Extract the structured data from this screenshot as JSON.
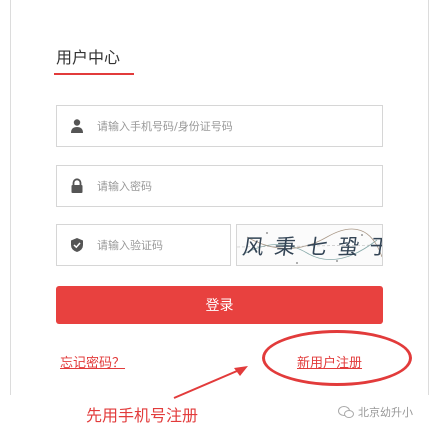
{
  "header": {
    "title": "用户中心"
  },
  "form": {
    "phone_placeholder": "请输入手机号码/身份证号码",
    "password_placeholder": "请输入密码",
    "captcha_placeholder": "请输入验证码",
    "captcha_text": "风 秉 七 蛩 于",
    "login_label": "登录"
  },
  "links": {
    "forgot_password": "忘记密码？",
    "register": "新用户注册"
  },
  "annotation": {
    "text": "先用手机号注册"
  },
  "watermark": {
    "text": "北京幼升小"
  },
  "colors": {
    "accent": "#e8413f",
    "annotation": "#e23b3b"
  },
  "icons": [
    "user-icon",
    "lock-icon",
    "shield-icon",
    "wechat-icon"
  ]
}
